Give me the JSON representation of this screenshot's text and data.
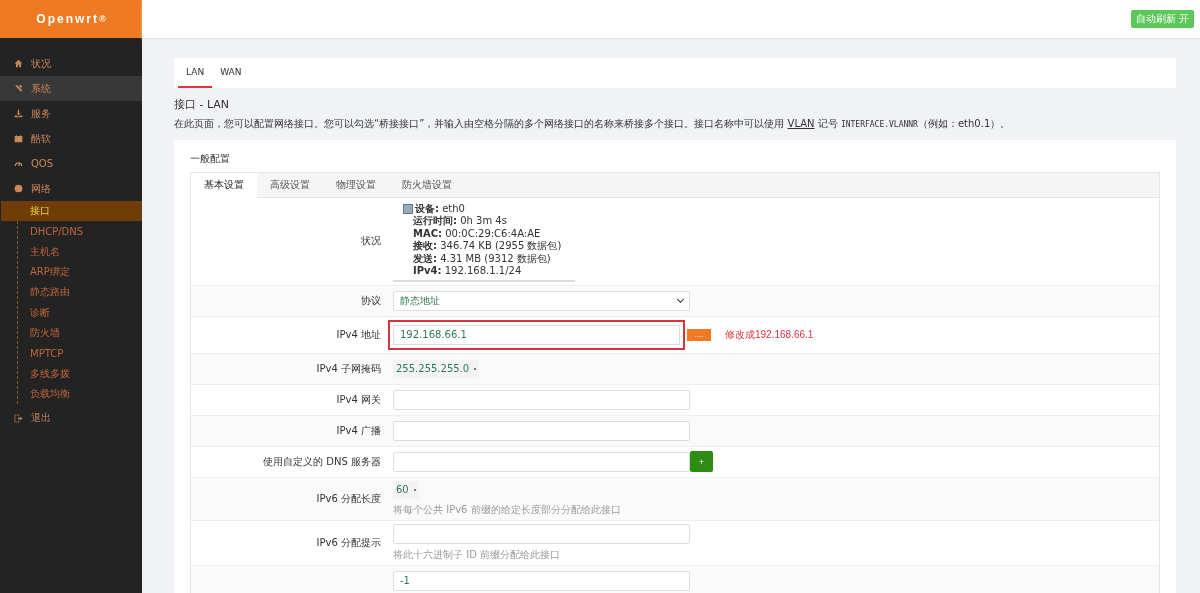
{
  "brand": {
    "name": "Openwrt",
    "mark": "®"
  },
  "header": {
    "badge": "自动刷新 开"
  },
  "sidebar": {
    "items": [
      {
        "label": "状况",
        "selected": false
      },
      {
        "label": "系统",
        "selected": true
      },
      {
        "label": "服务",
        "selected": false
      },
      {
        "label": "酷软",
        "selected": false
      },
      {
        "label": "QOS",
        "selected": false
      },
      {
        "label": "网络",
        "selected": false,
        "children": [
          {
            "label": "接口",
            "selected": true
          },
          {
            "label": "DHCP/DNS",
            "selected": false
          },
          {
            "label": "主机名",
            "selected": false
          },
          {
            "label": "ARP绑定",
            "selected": false
          },
          {
            "label": "静态路由",
            "selected": false
          },
          {
            "label": "诊断",
            "selected": false
          },
          {
            "label": "防火墙",
            "selected": false
          },
          {
            "label": "MPTCP",
            "selected": false
          },
          {
            "label": "多线多拨",
            "selected": false
          },
          {
            "label": "负载均衡",
            "selected": false
          }
        ]
      },
      {
        "label": "退出",
        "selected": false
      }
    ]
  },
  "tabs": [
    {
      "label": "LAN",
      "selected": true
    },
    {
      "label": "WAN",
      "selected": false
    }
  ],
  "page": {
    "title": "接口 - LAN",
    "description": "在此页面，您可以配置网络接口。您可以勾选“桥接接口”，并输入由空格分隔的多个网络接口的名称来桥接多个接口。接口名称中可以使用 ",
    "link": "VLAN",
    "description_tail": " 记号 ",
    "code": "INTERFACE.VLANNR",
    "description_end": "（例如：eth0.1）。"
  },
  "section": {
    "title": "一般配置",
    "tabs": [
      {
        "label": "基本设置",
        "selected": true
      },
      {
        "label": "高级设置",
        "selected": false
      },
      {
        "label": "物理设置",
        "selected": false
      },
      {
        "label": "防火墙设置",
        "selected": false
      }
    ]
  },
  "rows": [
    {
      "kind": "status",
      "label": "状况",
      "lines": [
        {
          "key": "设备:",
          "value": "eth0"
        },
        {
          "key": "运行时间:",
          "value": "0h 3m 4s"
        },
        {
          "key": "MAC:",
          "value": "00:0C:29:C6:4A:AE"
        },
        {
          "key": "接收:",
          "value": "346.74 KB (2955 数据包)"
        },
        {
          "key": "发送:",
          "value": "4.31 MB (9312 数据包)"
        },
        {
          "key": "IPv4:",
          "value": "192.168.1.1/24"
        }
      ]
    },
    {
      "kind": "select",
      "label": "协议",
      "value": "静态地址"
    },
    {
      "kind": "text",
      "label": "IPv4 地址",
      "value": "192.168.66.1",
      "highlighted": true,
      "button": "....",
      "annotation": "修改成192.168.66.1"
    },
    {
      "kind": "combo",
      "label": "IPv4 子网掩码",
      "value": "255.255.255.0"
    },
    {
      "kind": "text",
      "label": "IPv4 网关",
      "highlighted": false
    },
    {
      "kind": "text",
      "label": "IPv4 广播",
      "highlighted": false
    },
    {
      "kind": "text",
      "label": "使用自定义的 DNS 服务器",
      "highlighted": false,
      "add_button": "+"
    },
    {
      "kind": "combo",
      "label": "IPv6 分配长度",
      "value": "60",
      "help": "将每个公共 IPv6 前缀的给定长度部分分配给此接口"
    },
    {
      "kind": "text",
      "label": "IPv6 分配提示",
      "highlighted": false,
      "help": "将此十六进制子 ID 前缀分配给此接口"
    },
    {
      "kind": "text",
      "value": "-1",
      "highlighted": false
    }
  ]
}
